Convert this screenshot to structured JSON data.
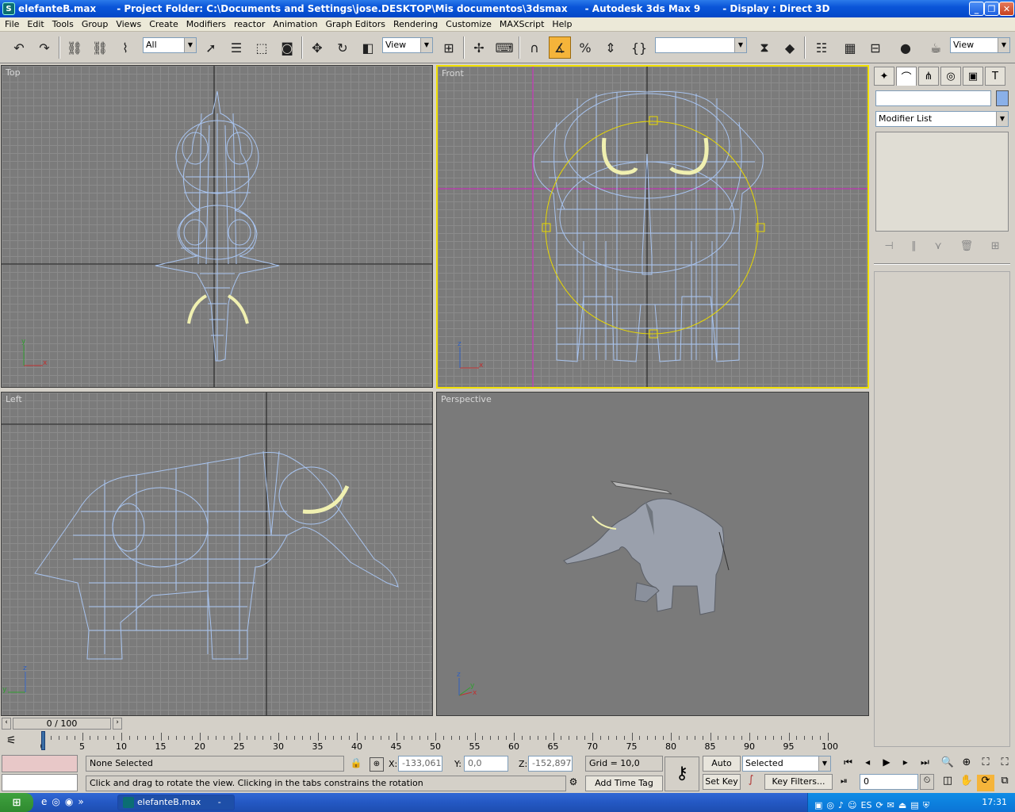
{
  "titlebar": {
    "filename": "elefanteB.max",
    "project": "- Project Folder: C:\\Documents and Settings\\jose.DESKTOP\\Mis documentos\\3dsmax",
    "app": "- Autodesk 3ds Max 9",
    "display": "- Display : Direct 3D"
  },
  "menubar": [
    "File",
    "Edit",
    "Tools",
    "Group",
    "Views",
    "Create",
    "Modifiers",
    "reactor",
    "Animation",
    "Graph Editors",
    "Rendering",
    "Customize",
    "MAXScript",
    "Help"
  ],
  "toolbar": {
    "selection_filter": "All",
    "coord_system": "View",
    "named_selection": "",
    "view_combo": "View"
  },
  "viewports": {
    "top": "Top",
    "front": "Front",
    "left": "Left",
    "perspective": "Perspective"
  },
  "command_panel": {
    "name_field": "",
    "modifier_list": "Modifier List"
  },
  "time_slider": {
    "frame": "0 / 100"
  },
  "trackbar": {
    "ticks": [
      "0",
      "5",
      "10",
      "15",
      "20",
      "25",
      "30",
      "35",
      "40",
      "45",
      "50",
      "55",
      "60",
      "65",
      "70",
      "75",
      "80",
      "85",
      "90",
      "95",
      "100"
    ]
  },
  "status": {
    "selection": "None Selected",
    "prompt": "Click and drag to rotate the view.  Clicking in the tabs constrains the rotation",
    "x_label": "X:",
    "x_value": "-133,061",
    "y_label": "Y:",
    "y_value": "0,0",
    "z_label": "Z:",
    "z_value": "-152,897",
    "grid": "Grid = 10,0",
    "add_time_tag": "Add Time Tag",
    "auto_key": "Auto Key",
    "set_key": "Set Key",
    "key_mode": "Selected",
    "key_filters": "Key Filters...",
    "current_frame": "0"
  },
  "taskbar": {
    "start": "",
    "task1": "elefanteB.max",
    "task2": "- P...",
    "clock": "17:31"
  },
  "colors": {
    "active_viewport": "#f0e000",
    "wireframe": "#a8c4f0",
    "tusk": "#f0f0b0",
    "gizmo": "#e8d800",
    "construction_line": "#d020c0"
  }
}
